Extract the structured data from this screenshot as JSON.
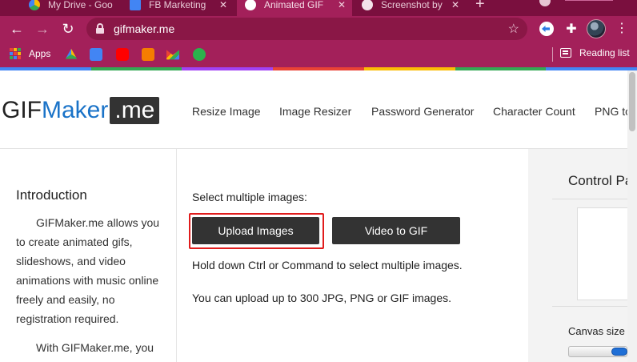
{
  "browser": {
    "tabs": [
      {
        "title": "My Drive - Goo",
        "favicon_color": "#4a89dc"
      },
      {
        "title": "FB Marketing",
        "favicon_color": "#4285f4"
      },
      {
        "title": "Animated GIF",
        "favicon_color": "#ffffff",
        "active": true
      },
      {
        "title": "Screenshot by",
        "favicon_color": "#ffffff"
      }
    ],
    "url": "gifmaker.me",
    "bookmarks": {
      "apps_label": "Apps",
      "icons": [
        "google-drive",
        "google-translate",
        "youtube",
        "blogger",
        "gmail",
        "feedly"
      ],
      "reading_list_label": "Reading list"
    },
    "theme_color": "#a3205a"
  },
  "site": {
    "logo": {
      "part1": "GIF",
      "part2": "Maker",
      "part3": ".me"
    },
    "nav": [
      "Resize Image",
      "Image Resizer",
      "Password Generator",
      "Character Count",
      "PNG to"
    ],
    "sidebar": {
      "heading": "Introduction",
      "para1": "GIFMaker.me allows you to create animated gifs, slideshows, and video animations with music online freely and easily, no registration required.",
      "para2": "With GIFMaker.me, you can also"
    },
    "main": {
      "select_label": "Select multiple images:",
      "upload_button": "Upload Images",
      "video_button": "Video to GIF",
      "hint1": "Hold down Ctrl or Command to select multiple images.",
      "hint2": "You can upload up to 300 JPG, PNG or GIF images."
    },
    "control_panel": {
      "title": "Control Panel",
      "canvas_size_label": "Canvas size"
    },
    "colors": {
      "accent_blue": "#1a73c8",
      "button_dark": "#333333",
      "highlight_red": "#e11c1c"
    }
  }
}
